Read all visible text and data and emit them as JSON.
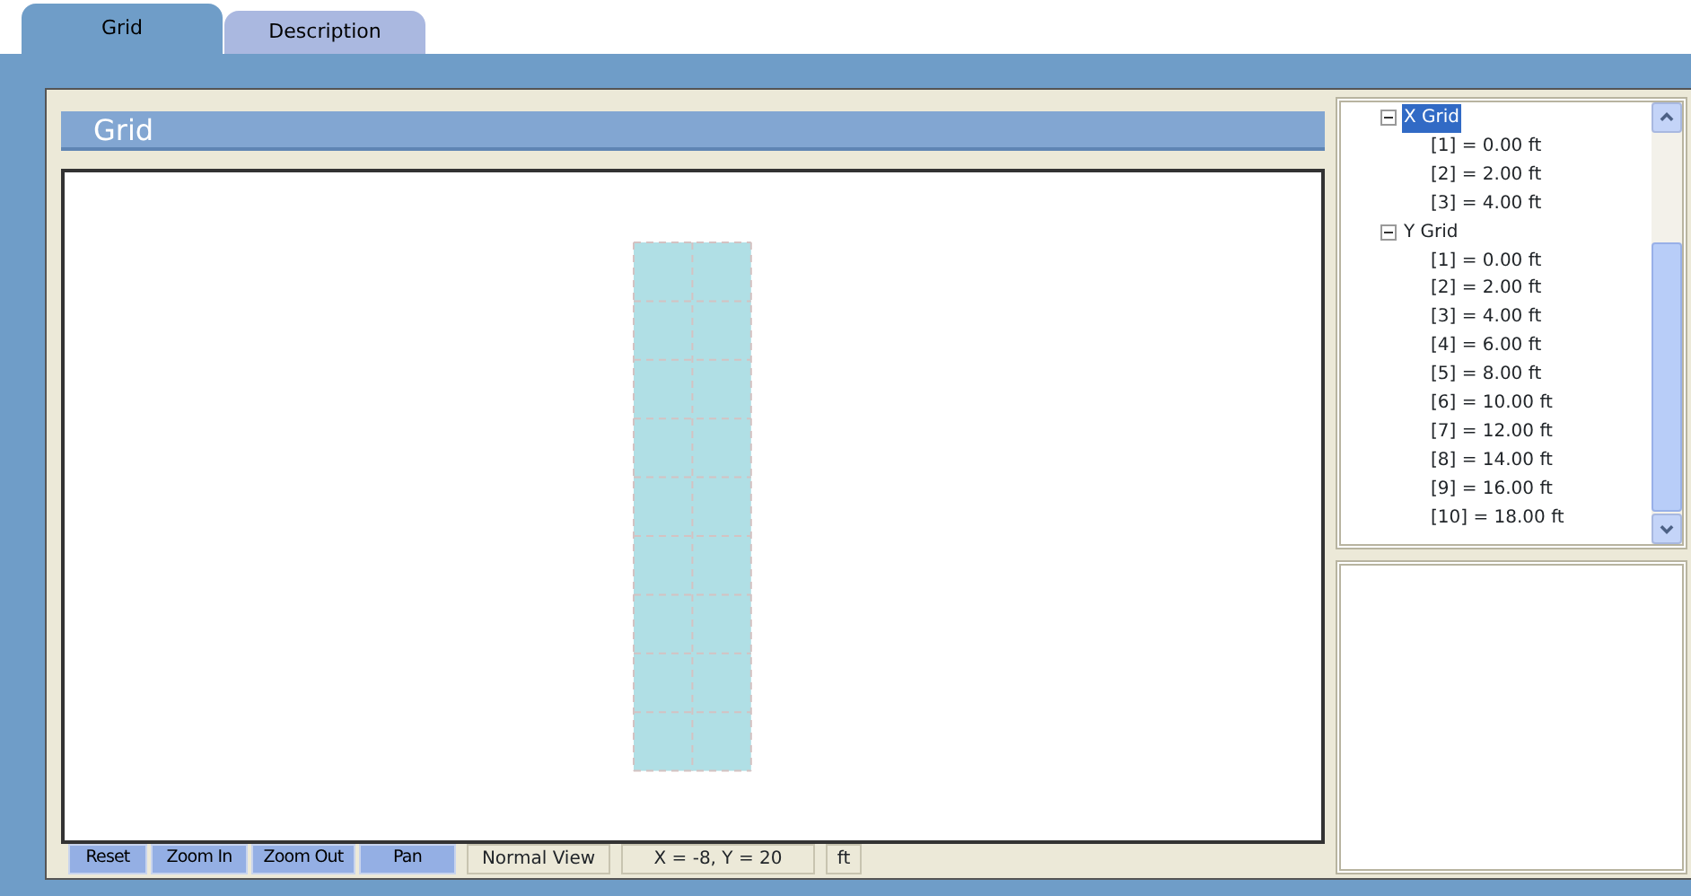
{
  "tabs": [
    {
      "label": "Grid",
      "selected": true
    },
    {
      "label": "Description",
      "selected": false
    }
  ],
  "panel_title": "Grid",
  "toolbar": {
    "buttons": [
      "Reset",
      "Zoom In",
      "Zoom Out",
      "Pan"
    ],
    "view_mode": "Normal View",
    "coordinates": "X = -8, Y = 20",
    "units": "ft"
  },
  "tree": [
    {
      "label": "X Grid",
      "expanded": true,
      "selected": true,
      "children": [
        {
          "label": "[1] =  0.00 ft"
        },
        {
          "label": "[2] =  2.00 ft"
        },
        {
          "label": "[3] =  4.00 ft"
        }
      ]
    },
    {
      "label": "Y Grid",
      "expanded": true,
      "selected": false,
      "children": [
        {
          "label": "[1] =  0.00 ft"
        },
        {
          "label": "[2] =  2.00 ft"
        },
        {
          "label": "[3] =  4.00 ft"
        },
        {
          "label": "[4] =  6.00 ft"
        },
        {
          "label": "[5] =  8.00 ft"
        },
        {
          "label": "[6] = 10.00 ft"
        },
        {
          "label": "[7] = 12.00 ft"
        },
        {
          "label": "[8] = 14.00 ft"
        },
        {
          "label": "[9] = 16.00 ft"
        },
        {
          "label": "[10] = 18.00 ft"
        }
      ]
    }
  ]
}
